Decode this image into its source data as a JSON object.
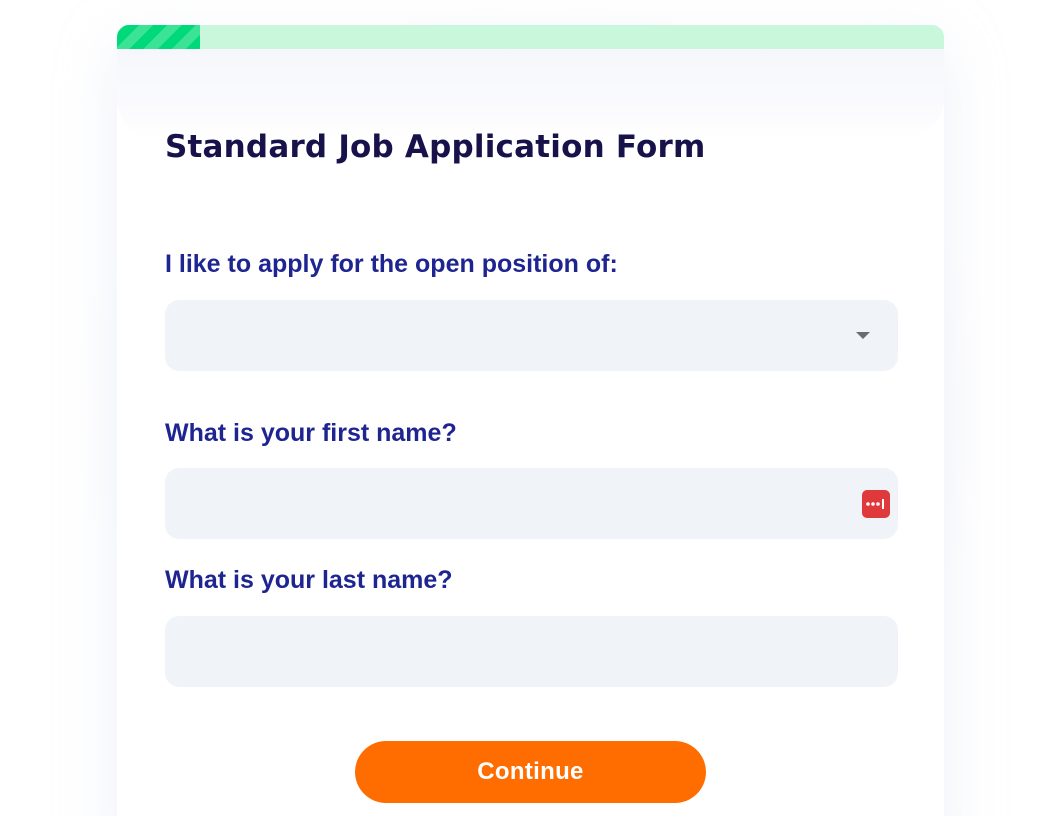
{
  "progress": {
    "fraction": 0.1,
    "colors": {
      "track": "#c9f7dc",
      "fill": "#00d97a",
      "stripe": "#3be396"
    }
  },
  "form": {
    "title": "Standard Job Application Form",
    "fields": [
      {
        "label": "I like to apply for the open position of:",
        "type": "select",
        "value": "",
        "icon": "chevron-down-icon"
      },
      {
        "label": "What is your first name?",
        "type": "text",
        "value": "",
        "icon": "password-manager-icon"
      },
      {
        "label": "What is your last name?",
        "type": "text",
        "value": ""
      }
    ],
    "continue_label": "Continue"
  },
  "colors": {
    "title": "#17134a",
    "label": "#1f2590",
    "input_bg": "#f0f4f9",
    "button": "#ff6d00",
    "button_text": "#ffffff",
    "pw_icon": "#e0393c"
  }
}
